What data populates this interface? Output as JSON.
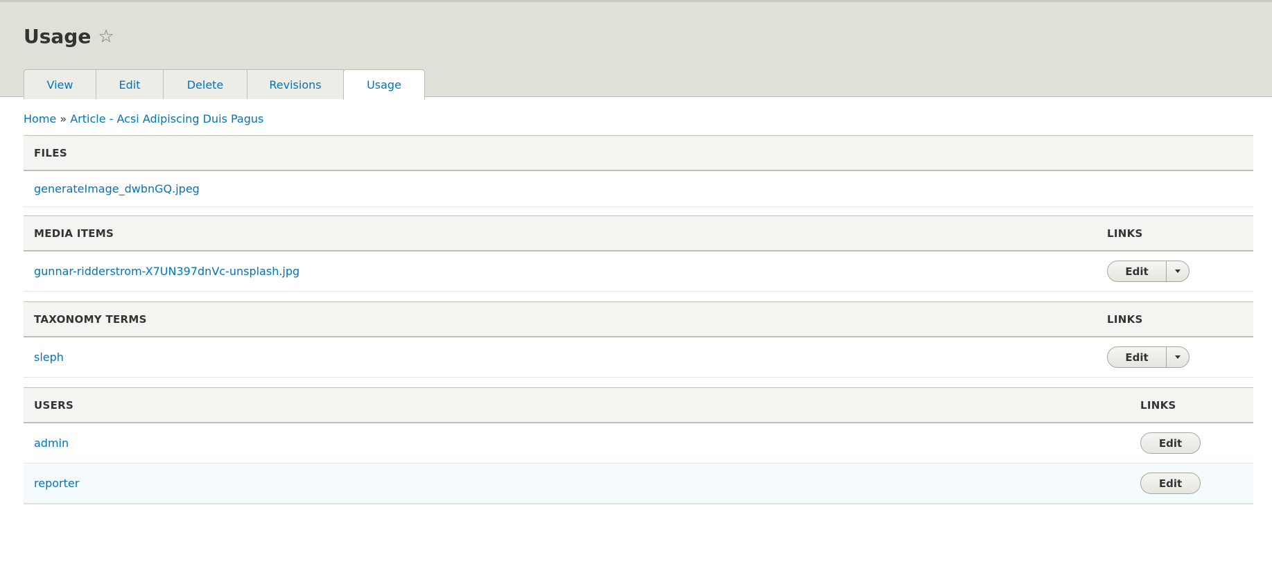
{
  "page": {
    "title": "Usage",
    "favorite_icon": "star-icon"
  },
  "tabs": [
    {
      "label": "View"
    },
    {
      "label": "Edit"
    },
    {
      "label": "Delete"
    },
    {
      "label": "Revisions"
    },
    {
      "label": "Usage",
      "active": true
    }
  ],
  "breadcrumb": {
    "home": "Home",
    "separator": "»",
    "current": "Article - Acsi Adipiscing Duis Pagus"
  },
  "files": {
    "header": "Files",
    "rows": [
      "generateImage_dwbnGQ.jpeg"
    ]
  },
  "media": {
    "header": "Media items",
    "links_header": "Links",
    "rows": [
      {
        "name": "gunnar-ridderstrom-X7UN397dnVc-unsplash.jpg",
        "action": "Edit"
      }
    ]
  },
  "taxonomy": {
    "header": "Taxonomy terms",
    "links_header": "Links",
    "rows": [
      {
        "name": "sleph",
        "action": "Edit"
      }
    ]
  },
  "users": {
    "header": "Users",
    "links_header": "Links",
    "rows": [
      {
        "name": "admin",
        "action": "Edit"
      },
      {
        "name": "reporter",
        "action": "Edit"
      }
    ]
  }
}
